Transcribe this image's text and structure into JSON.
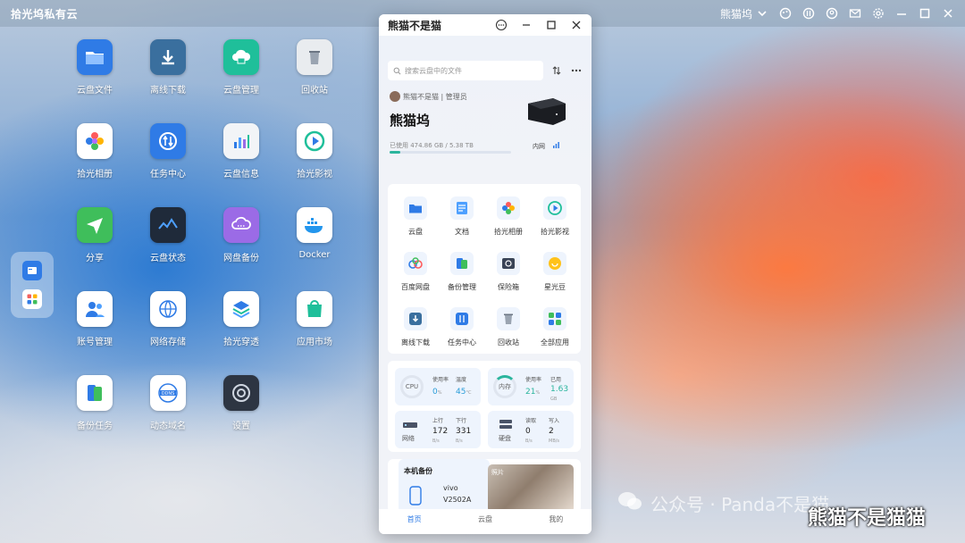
{
  "topbar": {
    "title": "拾光坞私有云",
    "user": "熊猫坞"
  },
  "desktop": {
    "items": [
      {
        "label": "云盘文件",
        "icon": "folder-icon",
        "color": "#2f7be6"
      },
      {
        "label": "离线下载",
        "icon": "download-icon",
        "color": "#3a6f9e"
      },
      {
        "label": "云盘管理",
        "icon": "cloud-drive-icon",
        "color": "#1fbf9a"
      },
      {
        "label": "回收站",
        "icon": "trash-icon",
        "color": "#e9ecef"
      },
      {
        "label": "拾光相册",
        "icon": "photos-icon",
        "color": "#ffffff"
      },
      {
        "label": "任务中心",
        "icon": "tasks-icon",
        "color": "#2f7be6"
      },
      {
        "label": "云盘信息",
        "icon": "info-chart-icon",
        "color": "#f2f4f7"
      },
      {
        "label": "拾光影视",
        "icon": "video-play-icon",
        "color": "#ffffff"
      },
      {
        "label": "分享",
        "icon": "share-icon",
        "color": "#3fbe5b"
      },
      {
        "label": "云盘状态",
        "icon": "status-graph-icon",
        "color": "#1f2a3a"
      },
      {
        "label": "网盘备份",
        "icon": "cloud-backup-icon",
        "color": "#9b6be6"
      },
      {
        "label": "Docker",
        "icon": "docker-icon",
        "color": "#ffffff"
      },
      {
        "label": "账号管理",
        "icon": "users-icon",
        "color": "#ffffff"
      },
      {
        "label": "网络存储",
        "icon": "network-storage-icon",
        "color": "#ffffff"
      },
      {
        "label": "拾光穿透",
        "icon": "layers-icon",
        "color": "#ffffff"
      },
      {
        "label": "应用市场",
        "icon": "app-store-icon",
        "color": "#ffffff"
      },
      {
        "label": "备份任务",
        "icon": "backup-task-icon",
        "color": "#ffffff"
      },
      {
        "label": "动态域名",
        "icon": "ddns-icon",
        "color": "#ffffff"
      },
      {
        "label": "设置",
        "icon": "settings-icon",
        "color": "#2d3542"
      }
    ]
  },
  "window": {
    "title": "熊猫不是猫",
    "search_placeholder": "搜索云盘中的文件",
    "owner": "熊猫不是猫 | 管理员",
    "nas_name": "熊猫坞",
    "usage_text": "已使用 474.86 GB / 5.38 TB",
    "usage_fraction": 0.09,
    "network_label": "内网",
    "apps": [
      {
        "label": "云盘",
        "icon": "folder-icon"
      },
      {
        "label": "文档",
        "icon": "document-icon"
      },
      {
        "label": "拾光相册",
        "icon": "photos-icon"
      },
      {
        "label": "拾光影视",
        "icon": "video-play-icon"
      },
      {
        "label": "百度网盘",
        "icon": "baidu-cloud-icon"
      },
      {
        "label": "备份管理",
        "icon": "backup-icon"
      },
      {
        "label": "保险箱",
        "icon": "safe-icon"
      },
      {
        "label": "星光豆",
        "icon": "star-bean-icon"
      },
      {
        "label": "离线下载",
        "icon": "download-icon"
      },
      {
        "label": "任务中心",
        "icon": "tasks-icon"
      },
      {
        "label": "回收站",
        "icon": "trash-icon"
      },
      {
        "label": "全部应用",
        "icon": "all-apps-icon"
      }
    ],
    "stats": {
      "cpu": {
        "label": "CPU",
        "usage_label": "使用率",
        "usage": "0",
        "usage_unit": "%",
        "temp_label": "温度",
        "temp": "45",
        "temp_unit": "°C"
      },
      "mem": {
        "label": "内存",
        "usage_label": "使用率",
        "usage": "21",
        "usage_unit": "%",
        "used_label": "已用",
        "used": "1.63",
        "used_unit": "GB"
      },
      "net": {
        "label": "网络",
        "up_label": "上行",
        "up": "172",
        "up_unit": "B/s",
        "down_label": "下行",
        "down": "331",
        "down_unit": "B/s"
      },
      "disk": {
        "label": "硬盘",
        "read_label": "读取",
        "read": "0",
        "read_unit": "B/s",
        "write_label": "写入",
        "write": "2",
        "write_unit": "MB/s"
      }
    },
    "backup": {
      "title": "本机备份",
      "device": "vivo V2502A",
      "photo_label": "照片"
    },
    "tabs": [
      "首页",
      "云盘",
      "我的"
    ]
  },
  "watermark": {
    "text": "公众号 · Panda不是猫",
    "overlay": "熊猫不是猫猫"
  },
  "colors": {
    "accent": "#2f7be6",
    "green": "#2bb59d"
  }
}
